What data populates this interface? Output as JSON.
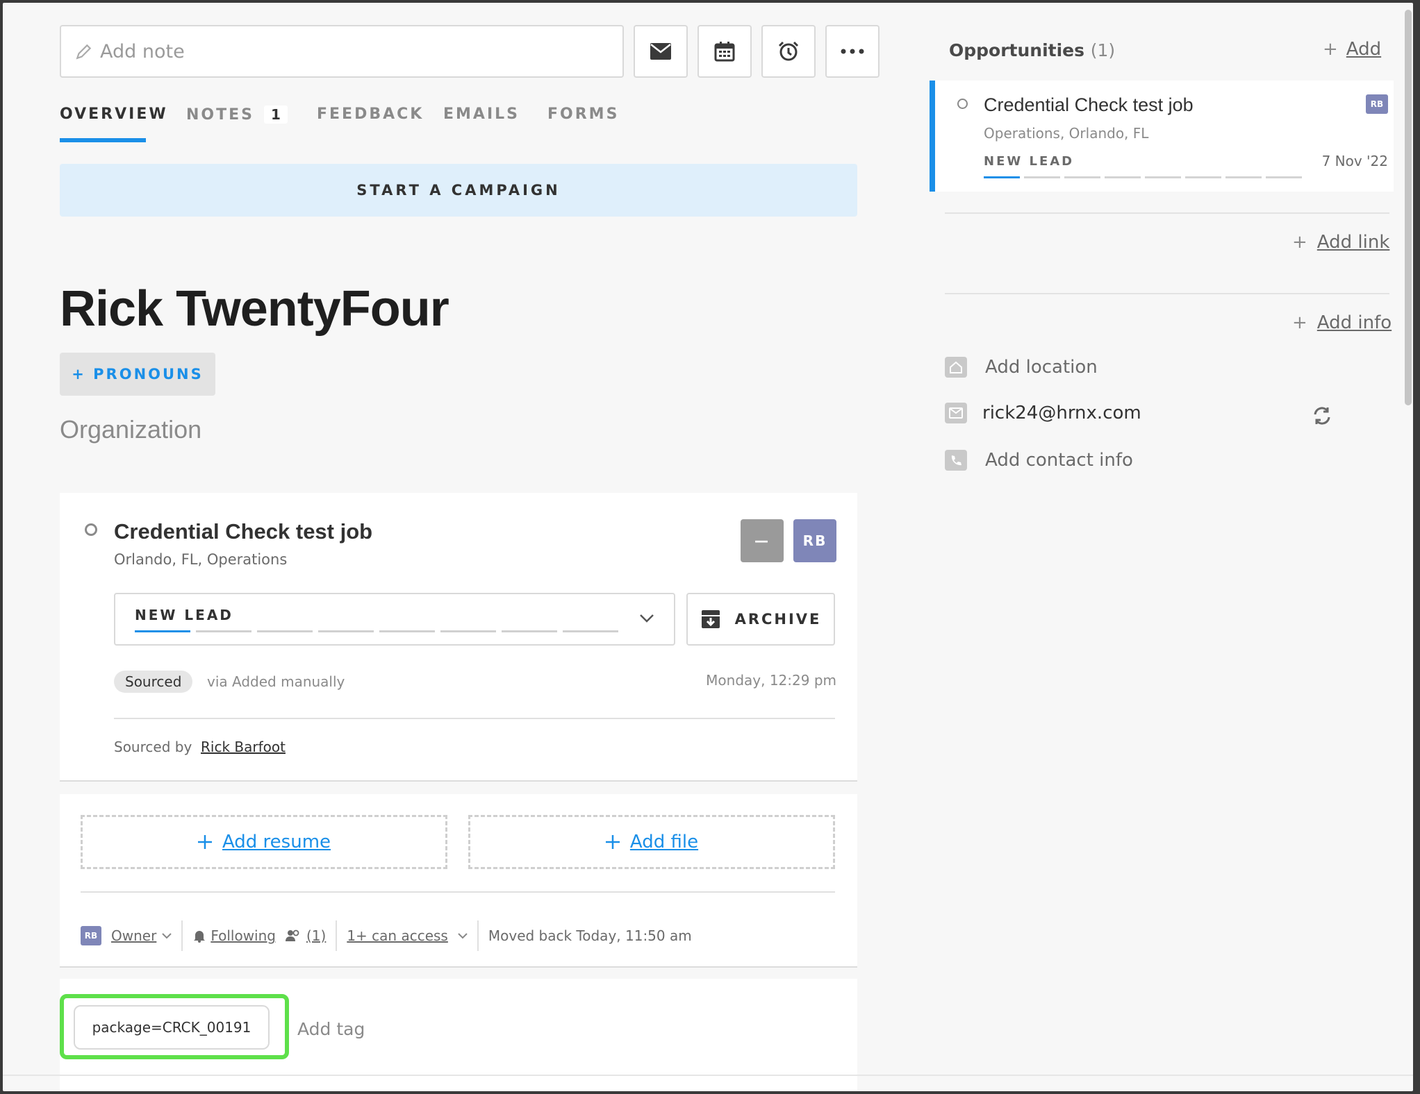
{
  "toolbar": {
    "note_placeholder": "Add note",
    "icons": [
      "mail-icon",
      "calendar-icon",
      "alarm-icon",
      "more-icon"
    ]
  },
  "tabs": [
    {
      "label": "OVERVIEW",
      "active": true
    },
    {
      "label": "NOTES",
      "count": "1"
    },
    {
      "label": "FEEDBACK"
    },
    {
      "label": "EMAILS"
    },
    {
      "label": "FORMS"
    }
  ],
  "campaign_label": "START A CAMPAIGN",
  "candidate": {
    "name": "Rick TwentyFour",
    "pronouns_label": "+ PRONOUNS",
    "organization": "Organization"
  },
  "job": {
    "title": "Credential Check test job",
    "location": "Orlando, FL, Operations",
    "assignee_minus": "—",
    "assignee_initials": "RB",
    "stage": "NEW LEAD",
    "archive_label": "ARCHIVE",
    "source_pill": "Sourced",
    "source_via": "via Added manually",
    "timestamp": "Monday, 12:29 pm",
    "sourced_by_label": "Sourced by",
    "sourced_by_name": "Rick Barfoot"
  },
  "files": {
    "add_resume": "Add resume",
    "add_file": "Add file"
  },
  "ownership": {
    "owner_initials": "RB",
    "owner_label": "Owner",
    "following_label": "Following",
    "followers_count": "(1)",
    "access_label": "1+ can access",
    "moved_text": "Moved back Today, 11:50 am"
  },
  "tags": {
    "chip": "package=CRCK_00191",
    "add_label": "Add tag"
  },
  "sidebar": {
    "opportunities_label": "Opportunities",
    "opportunities_count": "(1)",
    "add_label": "Add",
    "opportunity": {
      "title": "Credential Check test job",
      "location": "Operations, Orlando, FL",
      "stage": "NEW LEAD",
      "date": "7 Nov '22",
      "initials": "RB"
    },
    "add_link": "Add link",
    "add_info": "Add info",
    "location": "Add location",
    "email": "rick24@hrnx.com",
    "contact": "Add contact info"
  },
  "colors": {
    "accent": "#1a8fe8",
    "campaign_bg": "#dfeffb",
    "tag_highlight": "#5ee04a",
    "avatar": "#7f86b8"
  }
}
